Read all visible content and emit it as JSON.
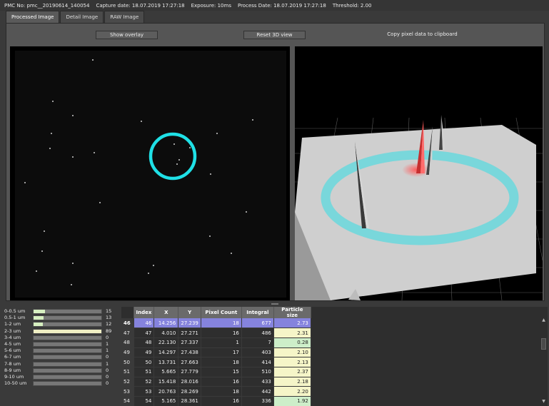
{
  "info": {
    "pmc": "PMC No: pmc__20190614_140054",
    "capture": "Capture date: 18.07.2019 17:27:18",
    "exposure": "Exposure: 10ms",
    "process": "Process Date: 18.07.2019 17:27:18",
    "threshold": "Threshold: 2.00"
  },
  "tabs": [
    "Processed Image",
    "Detail Image",
    "RAW Image"
  ],
  "buttons": {
    "overlay": "Show overlay",
    "reset3d": "Reset 3D view",
    "copy": "Copy pixel data to clipboard"
  },
  "colors": {
    "overlay_ring": "#1fe0e6",
    "selected_row": "#8583dd",
    "yellow_cell": "#f5f5c8",
    "green_cell": "#cdeec9"
  },
  "histogram": [
    {
      "label": "0-0.5 um",
      "count": "15",
      "fill": 0.17,
      "color": "green"
    },
    {
      "label": "0.5-1 um",
      "count": "13",
      "fill": 0.15,
      "color": "green"
    },
    {
      "label": "1-2 um",
      "count": "12",
      "fill": 0.14,
      "color": "green"
    },
    {
      "label": "2-3 um",
      "count": "89",
      "fill": 1.0,
      "color": "yellow"
    },
    {
      "label": "3-4 um",
      "count": "0",
      "fill": 0,
      "color": "yellow"
    },
    {
      "label": "4-5 um",
      "count": "1",
      "fill": 0,
      "color": "yellow"
    },
    {
      "label": "5-6 um",
      "count": "1",
      "fill": 0,
      "color": "yellow"
    },
    {
      "label": "6-7 um",
      "count": "0",
      "fill": 0,
      "color": "yellow"
    },
    {
      "label": "7-8 um",
      "count": "1",
      "fill": 0,
      "color": "yellow"
    },
    {
      "label": "8-9 um",
      "count": "0",
      "fill": 0,
      "color": "yellow"
    },
    {
      "label": "9-10 um",
      "count": "0",
      "fill": 0,
      "color": "yellow"
    },
    {
      "label": "10-50 um",
      "count": "0",
      "fill": 0,
      "color": "yellow"
    }
  ],
  "table": {
    "headers": [
      "",
      "Index",
      "X",
      "Y",
      "Pixel Count",
      "Integral",
      "Particle size"
    ],
    "rows": [
      {
        "row": "46",
        "index": "46",
        "x": "14.256",
        "y": "27.239",
        "pixels": "18",
        "integral": "677",
        "size": "2.73",
        "tone": "yellow",
        "selected": true
      },
      {
        "row": "47",
        "index": "47",
        "x": "4.010",
        "y": "27.271",
        "pixels": "16",
        "integral": "486",
        "size": "2.31",
        "tone": "yellow",
        "selected": false
      },
      {
        "row": "48",
        "index": "48",
        "x": "22.130",
        "y": "27.337",
        "pixels": "1",
        "integral": "7",
        "size": "0.28",
        "tone": "green",
        "selected": false
      },
      {
        "row": "49",
        "index": "49",
        "x": "14.297",
        "y": "27.438",
        "pixels": "17",
        "integral": "403",
        "size": "2.10",
        "tone": "yellow",
        "selected": false
      },
      {
        "row": "50",
        "index": "50",
        "x": "13.731",
        "y": "27.663",
        "pixels": "18",
        "integral": "414",
        "size": "2.13",
        "tone": "yellow",
        "selected": false
      },
      {
        "row": "51",
        "index": "51",
        "x": "5.665",
        "y": "27.779",
        "pixels": "15",
        "integral": "510",
        "size": "2.37",
        "tone": "yellow",
        "selected": false
      },
      {
        "row": "52",
        "index": "52",
        "x": "15.418",
        "y": "28.016",
        "pixels": "16",
        "integral": "433",
        "size": "2.18",
        "tone": "yellow",
        "selected": false
      },
      {
        "row": "53",
        "index": "53",
        "x": "20.763",
        "y": "28.269",
        "pixels": "18",
        "integral": "442",
        "size": "2.20",
        "tone": "yellow",
        "selected": false
      },
      {
        "row": "54",
        "index": "54",
        "x": "5.165",
        "y": "28.361",
        "pixels": "16",
        "integral": "336",
        "size": "1.92",
        "tone": "green",
        "selected": false
      }
    ]
  }
}
